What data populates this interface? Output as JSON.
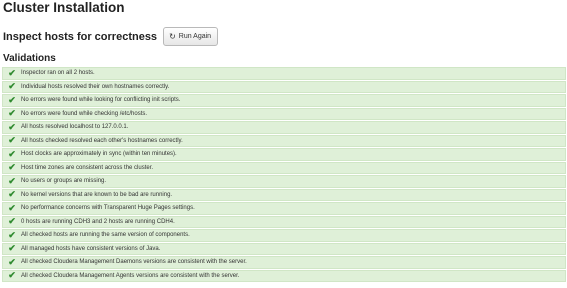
{
  "page": {
    "title": "Cluster Installation"
  },
  "inspect": {
    "heading": "Inspect hosts for correctness",
    "button_icon": "refresh-icon",
    "button_label": "Run Again"
  },
  "validations": {
    "heading": "Validations",
    "item_icon": "check-icon",
    "items": [
      "Inspector ran on all 2 hosts.",
      "Individual hosts resolved their own hostnames correctly.",
      "No errors were found while looking for conflicting init scripts.",
      "No errors were found while checking /etc/hosts.",
      "All hosts resolved localhost to 127.0.0.1.",
      "All hosts checked resolved each other's hostnames correctly.",
      "Host clocks are approximately in sync (within ten minutes).",
      "Host time zones are consistent across the cluster.",
      "No users or groups are missing.",
      "No kernel versions that are known to be bad are running.",
      "No performance concerns with Transparent Huge Pages settings.",
      "0 hosts are running CDH3 and 2 hosts are running CDH4.",
      "All checked hosts are running the same version of components.",
      "All managed hosts have consistent versions of Java.",
      "All checked Cloudera Management Daemons versions are consistent with the server.",
      "All checked Cloudera Management Agents versions are consistent with the server."
    ]
  },
  "colors": {
    "success_background": "#dff0d8",
    "check_green": "#2f8a2f"
  }
}
